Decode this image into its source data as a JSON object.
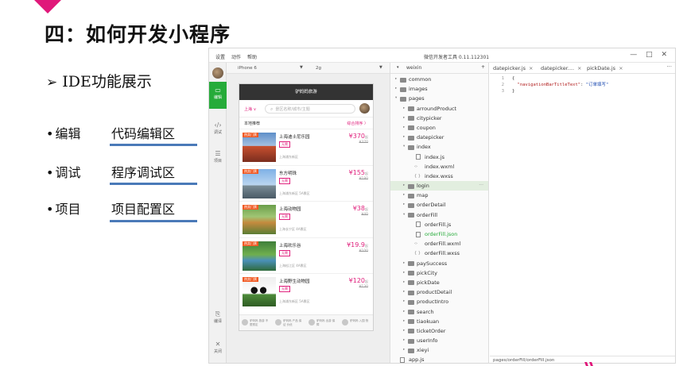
{
  "slide": {
    "title": "四：如何开发小程序",
    "heading_arrow": "➢",
    "heading": "IDE功能展示",
    "features": [
      {
        "name": "编辑",
        "desc": "代码编辑区"
      },
      {
        "name": "调试",
        "desc": "程序调试区"
      },
      {
        "name": "项目",
        "desc": "项目配置区"
      }
    ],
    "bullet": "•"
  },
  "colors": {
    "accent": "#e0187a",
    "underline": "#4a7ab8",
    "ide_green": "#26ab3a",
    "price": "#e0217d"
  },
  "ide": {
    "menu": [
      "设置",
      "动作",
      "帮助"
    ],
    "app_title": "微信开发者工具 0.11.112301",
    "window_controls": "— □ ✕",
    "leftbar": [
      {
        "label": "编辑",
        "icon": "code-window-icon"
      },
      {
        "label": "调试",
        "icon": "debug-icon"
      },
      {
        "label": "项目",
        "icon": "project-icon"
      },
      {
        "label": "编译",
        "icon": "compile-icon"
      },
      {
        "label": "关闭",
        "icon": "close-icon"
      }
    ],
    "simulator": {
      "device": "iPhone 6",
      "network": "2g",
      "nav_title": "驴妈妈旅游",
      "city": "上海 ∨",
      "search_placeholder": "景区名称/城市/主题",
      "sort_left": "本地推荐",
      "sort_right": "综合排序 〉",
      "items": [
        {
          "hot": "热卖门票",
          "name": "上海迪士尼乐园",
          "badge": "无需",
          "price": "¥370",
          "unit": "起",
          "orig": "¥370",
          "addr": "上海浦东新区"
        },
        {
          "hot": "热卖门票",
          "name": "东方明珠",
          "badge": "无需",
          "price": "¥155",
          "unit": "起",
          "orig": "¥180",
          "addr": "上海浦东新区 5A景区"
        },
        {
          "hot": "热卖门票",
          "name": "上海动物园",
          "badge": "无需",
          "price": "¥38",
          "unit": "起",
          "orig": "¥40",
          "addr": "上海长宁区 4A景区"
        },
        {
          "hot": "热卖门票",
          "name": "上海欢乐谷",
          "badge": "无需",
          "price": "¥19.9",
          "unit": "起",
          "orig": "¥100",
          "addr": "上海松江区 4A景区"
        },
        {
          "hot": "热卖门票",
          "name": "上海野生动物园",
          "badge": "无需",
          "price": "¥120",
          "unit": "起",
          "orig": "¥130",
          "addr": "上海浦东新区 5A景区"
        }
      ],
      "tabs": [
        {
          "text": "驴妈妈 旅游 不限预定"
        },
        {
          "text": "驴妈妈 产品 保证 价优"
        },
        {
          "text": "驴妈妈 出游 保障"
        },
        {
          "text": "驴妈妈 入园 快"
        }
      ]
    },
    "tree": {
      "header": "weixin",
      "items": [
        {
          "label": "common",
          "type": "folder",
          "depth": 0,
          "toggle": "▸"
        },
        {
          "label": "images",
          "type": "folder",
          "depth": 0,
          "toggle": "▸"
        },
        {
          "label": "pages",
          "type": "folder",
          "depth": 0,
          "toggle": "▾"
        },
        {
          "label": "arroundProduct",
          "type": "folder",
          "depth": 1,
          "toggle": "▸"
        },
        {
          "label": "citypicker",
          "type": "folder",
          "depth": 1,
          "toggle": "▸"
        },
        {
          "label": "coupon",
          "type": "folder",
          "depth": 1,
          "toggle": "▸"
        },
        {
          "label": "datepicker",
          "type": "folder",
          "depth": 1,
          "toggle": "▸"
        },
        {
          "label": "index",
          "type": "folder",
          "depth": 1,
          "toggle": "▾"
        },
        {
          "label": "index.js",
          "type": "file",
          "depth": 2,
          "prefix": ""
        },
        {
          "label": "index.wxml",
          "type": "file",
          "depth": 2,
          "prefix": "‹›"
        },
        {
          "label": "index.wxss",
          "type": "file",
          "depth": 2,
          "prefix": "{ }"
        },
        {
          "label": "login",
          "type": "folder",
          "depth": 1,
          "toggle": "▸",
          "selected": true
        },
        {
          "label": "map",
          "type": "folder",
          "depth": 1,
          "toggle": "▸"
        },
        {
          "label": "orderDetail",
          "type": "folder",
          "depth": 1,
          "toggle": "▸"
        },
        {
          "label": "orderFill",
          "type": "folder",
          "depth": 1,
          "toggle": "▾"
        },
        {
          "label": "orderFill.js",
          "type": "file",
          "depth": 2,
          "prefix": ""
        },
        {
          "label": "orderFill.json",
          "type": "file",
          "depth": 2,
          "prefix": "",
          "highlight": true
        },
        {
          "label": "orderFill.wxml",
          "type": "file",
          "depth": 2,
          "prefix": "‹›"
        },
        {
          "label": "orderFill.wxss",
          "type": "file",
          "depth": 2,
          "prefix": "{ }"
        },
        {
          "label": "paySuccess",
          "type": "folder",
          "depth": 1,
          "toggle": "▸"
        },
        {
          "label": "pickCity",
          "type": "folder",
          "depth": 1,
          "toggle": "▸"
        },
        {
          "label": "pickDate",
          "type": "folder",
          "depth": 1,
          "toggle": "▸"
        },
        {
          "label": "productDetail",
          "type": "folder",
          "depth": 1,
          "toggle": "▸"
        },
        {
          "label": "productIntro",
          "type": "folder",
          "depth": 1,
          "toggle": "▸"
        },
        {
          "label": "search",
          "type": "folder",
          "depth": 1,
          "toggle": "▸"
        },
        {
          "label": "tiaokuan",
          "type": "folder",
          "depth": 1,
          "toggle": "▸"
        },
        {
          "label": "ticketOrder",
          "type": "folder",
          "depth": 1,
          "toggle": "▸"
        },
        {
          "label": "userInfo",
          "type": "folder",
          "depth": 1,
          "toggle": "▸"
        },
        {
          "label": "xieyi",
          "type": "folder",
          "depth": 1,
          "toggle": "▸"
        },
        {
          "label": "app.js",
          "type": "file",
          "depth": 0,
          "prefix": ""
        }
      ],
      "more": "···"
    },
    "editor": {
      "tabs": [
        {
          "label": "datepicker.js"
        },
        {
          "label": "datepicker...."
        },
        {
          "label": "pickDate.js"
        }
      ],
      "close": "×",
      "more": "···",
      "lines": [
        {
          "num": "1",
          "text": "{"
        },
        {
          "num": "2",
          "key": "\"navigationBarTitleText\"",
          "sep": ": ",
          "val": "\"订单填写\""
        },
        {
          "num": "3",
          "text": "}"
        }
      ],
      "status": "pages/orderFill/orderFill.json"
    }
  }
}
